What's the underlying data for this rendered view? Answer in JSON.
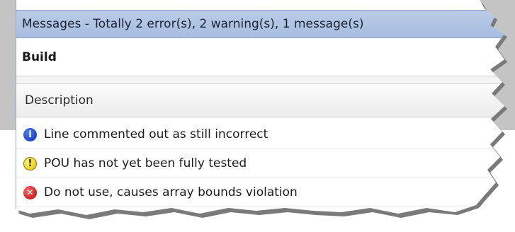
{
  "window": {
    "title": "Messages - Totally 2 error(s), 2 warning(s), 1 message(s)"
  },
  "toolbar": {
    "category": "Build"
  },
  "table": {
    "columns": [
      "Description"
    ],
    "rows": [
      {
        "type": "info",
        "icon": "info-icon",
        "text": "Line commented out as still incorrect"
      },
      {
        "type": "warning",
        "icon": "warning-icon",
        "text": "POU has not yet been fully tested"
      },
      {
        "type": "error",
        "icon": "error-icon",
        "text": "Do not use, causes array bounds violation"
      }
    ]
  },
  "icon_glyphs": {
    "info": "i",
    "warning": "!",
    "error": "✕"
  },
  "colors": {
    "titlebar": "#a7bde0",
    "info": "#0b2fb3",
    "warning": "#e0c300",
    "error": "#b40000"
  }
}
